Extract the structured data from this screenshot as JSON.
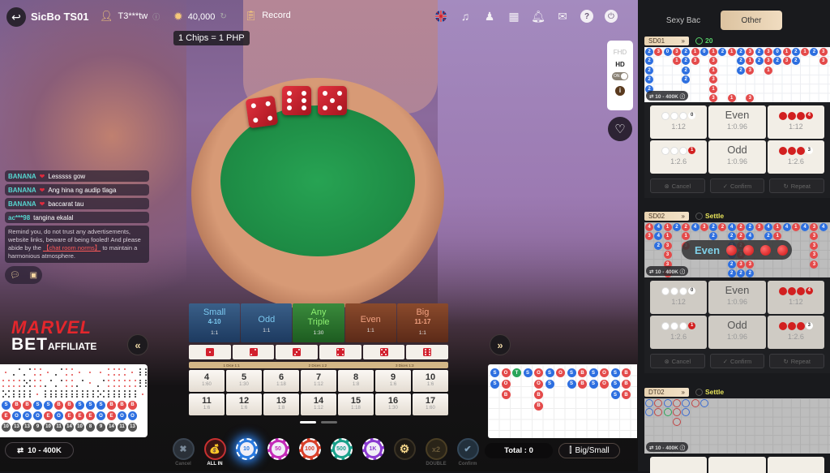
{
  "header": {
    "title": "SicBo TS01",
    "username": "T3***tw",
    "balance": "40,000",
    "record_label": "Record",
    "chip_rate": "1 Chips = 1 PHP",
    "icons": [
      "uk-flag-icon",
      "music-icon",
      "dealer-icon",
      "lobby-grid-icon",
      "bell-icon",
      "mail-icon",
      "help-icon",
      "power-icon"
    ]
  },
  "video_quality": {
    "fhd": "FHD",
    "hd": "HD",
    "toggle": "ON"
  },
  "dice_result": [
    4,
    6,
    5
  ],
  "chat": {
    "messages": [
      {
        "name": "BANANA",
        "vip": true,
        "text": "Lesssss gow"
      },
      {
        "name": "BANANA",
        "vip": true,
        "text": "Ang hina ng audip tlaga"
      },
      {
        "name": "BANANA",
        "vip": true,
        "text": "baccarat tau"
      },
      {
        "name": "ac***98",
        "vip": false,
        "text": "tangina ekalal"
      }
    ],
    "notice_pre": "Remind you, do not trust any advertisements, website links, beware of being fooled!  And please abide by the ",
    "notice_link": "【chat room norms】",
    "notice_post": " to maintain a harmonious atmosphere."
  },
  "logo": {
    "line1": "MARVEL",
    "line2": "BET",
    "line3": "AFFILIATE"
  },
  "bet_table": {
    "main": [
      {
        "label": "Small",
        "sub": "4-10",
        "odds": "1:1"
      },
      {
        "label": "Odd",
        "sub": "",
        "odds": "1:1"
      },
      {
        "label": "Any",
        "sub": "Triple",
        "odds": "1:30"
      },
      {
        "label": "Even",
        "sub": "",
        "odds": "1:1"
      },
      {
        "label": "Big",
        "sub": "11-17",
        "odds": "1:1"
      }
    ],
    "single_dice": [
      1,
      2,
      3,
      4,
      5,
      6
    ],
    "combo_labels": [
      "1 Dice 1:1",
      "2 Dices 1:2",
      "3 Dices 1:3"
    ],
    "sums": [
      {
        "n": "4",
        "odds": "1:60"
      },
      {
        "n": "5",
        "odds": "1:30"
      },
      {
        "n": "6",
        "odds": "1:18"
      },
      {
        "n": "7",
        "odds": "1:12"
      },
      {
        "n": "8",
        "odds": "1:8"
      },
      {
        "n": "9",
        "odds": "1:6"
      },
      {
        "n": "10",
        "odds": "1:6"
      },
      {
        "n": "11",
        "odds": "1:6"
      },
      {
        "n": "12",
        "odds": "1:6"
      },
      {
        "n": "13",
        "odds": "1:8"
      },
      {
        "n": "14",
        "odds": "1:12"
      },
      {
        "n": "15",
        "odds": "1:18"
      },
      {
        "n": "16",
        "odds": "1:30"
      },
      {
        "n": "17",
        "odds": "1:60"
      }
    ]
  },
  "chips": {
    "cancel": "Cancel",
    "allin": "ALL IN",
    "values": [
      {
        "label": "10",
        "color": "#2a7ae0",
        "selected": true
      },
      {
        "label": "50",
        "color": "#c42ab8"
      },
      {
        "label": "100",
        "color": "#d8402a"
      },
      {
        "label": "500",
        "color": "#1aa08a"
      },
      {
        "label": "1K",
        "color": "#8a3ad0"
      }
    ],
    "double": "DOUBLE",
    "confirm": "Confirm"
  },
  "bet_limit": "10 - 400K",
  "total_label": "Total : 0",
  "bigsmall_label": "Big/Small",
  "left_road": {
    "dice_rows": [
      [
        1,
        2,
        2,
        4,
        1,
        2,
        4,
        1,
        1,
        1,
        4,
        4,
        1,
        6
      ],
      [
        4,
        4,
        5,
        4,
        2,
        2,
        4,
        2,
        1,
        2,
        4,
        4,
        4,
        6
      ],
      [
        5,
        6,
        6,
        1,
        6,
        6,
        6,
        6,
        6,
        5,
        6,
        6,
        6,
        1
      ]
    ],
    "bs_row": [
      "S",
      "B",
      "B",
      "S",
      "S",
      "B",
      "B",
      "S",
      "S",
      "S",
      "B",
      "B",
      "B"
    ],
    "eo_row": [
      "E",
      "O",
      "O",
      "O",
      "E",
      "O",
      "E",
      "E",
      "E",
      "O",
      "E",
      "O",
      "O"
    ],
    "sum_row": [
      "10",
      "13",
      "13",
      "9",
      "10",
      "11",
      "14",
      "10",
      "8",
      "9",
      "14",
      "11",
      "13"
    ]
  },
  "right_road": {
    "columns": [
      [
        "S",
        "S"
      ],
      [
        "O",
        "O",
        "B"
      ],
      [
        "T"
      ],
      [
        "S"
      ],
      [
        "O",
        "O",
        "B",
        "B"
      ],
      [
        "S",
        "S"
      ],
      [
        "O"
      ],
      [
        "S",
        "S"
      ],
      [
        "B",
        "B"
      ],
      [
        "S",
        "S"
      ],
      [
        "O",
        "O"
      ],
      [
        "S",
        "S",
        "S"
      ],
      [
        "B",
        "B",
        "B"
      ]
    ]
  },
  "sidebar": {
    "tabs": [
      "Sexy Bac",
      "Other"
    ],
    "active_tab": "Other",
    "tables": [
      {
        "name": "SD01",
        "status": "20",
        "status_type": "countdown",
        "limit": "10 - 400K",
        "road": [
          [
            "2b",
            "2b",
            "2b",
            "2b",
            "2b"
          ],
          [
            "3r"
          ],
          [
            "0b"
          ],
          [
            "3r",
            "1r"
          ],
          [
            "2b",
            "2b",
            "2b",
            "2b"
          ],
          [
            "1r",
            "3r"
          ],
          [
            "0b"
          ],
          [
            "1r",
            "3r",
            "1r",
            "3r",
            "1r",
            "3r"
          ],
          [
            "2b"
          ],
          [
            "1r",
            "",
            "",
            "",
            "",
            "1r"
          ],
          [
            "2b",
            "2b",
            "2b"
          ],
          [
            "3r",
            "1r",
            "3r",
            "",
            "",
            "3r"
          ],
          [
            "2b",
            "2b"
          ],
          [
            "3r",
            "3r",
            "1r"
          ],
          [
            "0b",
            "2b"
          ],
          [
            "1r",
            "3r"
          ],
          [
            "2b",
            "2b"
          ],
          [
            "1r"
          ],
          [
            "2b"
          ],
          [
            "3r",
            "3r"
          ]
        ],
        "bets": [
          {
            "type": "white",
            "badge": "0",
            "odds": "1:12"
          },
          {
            "label": "Even",
            "odds": "1:0.96"
          },
          {
            "type": "red",
            "badge": "4",
            "odds": "1:12"
          },
          {
            "type": "white",
            "badge": "1",
            "odds": "1:2.6"
          },
          {
            "label": "Odd",
            "odds": "1:0.96"
          },
          {
            "type": "red",
            "badge": "3",
            "odds": "1:2.6"
          }
        ],
        "actions": [
          "Cancel",
          "Confirm",
          "Repeat"
        ]
      },
      {
        "name": "SD02",
        "status": "Settle",
        "status_type": "settle",
        "limit": "10 - 400K",
        "result_label": "Even",
        "result_balls": 4,
        "road": [
          [
            "4r",
            "3r"
          ],
          [
            "4b",
            "4b",
            "2b"
          ],
          [
            "1r",
            "1r",
            "3r",
            "3r",
            "3r",
            "3r"
          ],
          [
            "2b"
          ],
          [
            "2r",
            "1r",
            "3r"
          ],
          [
            "4b"
          ],
          [
            "3r"
          ],
          [
            "2b",
            "2b"
          ],
          [
            "2r"
          ],
          [
            "4b",
            "2b",
            "2b",
            "2b",
            "2b",
            "2b"
          ],
          [
            "2r",
            "2r",
            "2r",
            "3r",
            "3r",
            "2b"
          ],
          [
            "2b",
            "4b",
            "",
            "",
            "3r",
            "2b"
          ],
          [
            "3r"
          ],
          [
            "4b",
            "2b"
          ],
          [
            "1r",
            "1r"
          ],
          [
            "4b"
          ],
          [
            "1r"
          ],
          [
            "4b"
          ],
          [
            "3r",
            "3r",
            "3r",
            "3r",
            "3r"
          ],
          [
            "4b"
          ]
        ],
        "bets": [
          {
            "type": "white",
            "badge": "0",
            "odds": "1:12"
          },
          {
            "label": "Even",
            "odds": "1:0.96"
          },
          {
            "type": "red",
            "badge": "4",
            "odds": "1:12"
          },
          {
            "type": "white",
            "badge": "1",
            "odds": "1:2.6"
          },
          {
            "label": "Odd",
            "odds": "1:0.96"
          },
          {
            "type": "red",
            "badge": "3",
            "odds": "1:2.6"
          }
        ],
        "actions": [
          "Cancel",
          "Confirm",
          "Repeat"
        ]
      },
      {
        "name": "DT02",
        "status": "Settle",
        "status_type": "settle",
        "limit": "10 - 400K",
        "road": [
          [
            "b",
            "b"
          ],
          [
            "r",
            "r"
          ],
          [
            "b",
            "g"
          ],
          [
            "r",
            "r",
            "r"
          ],
          [
            "b",
            "b"
          ],
          [
            "r"
          ],
          [
            "b"
          ]
        ]
      }
    ]
  }
}
